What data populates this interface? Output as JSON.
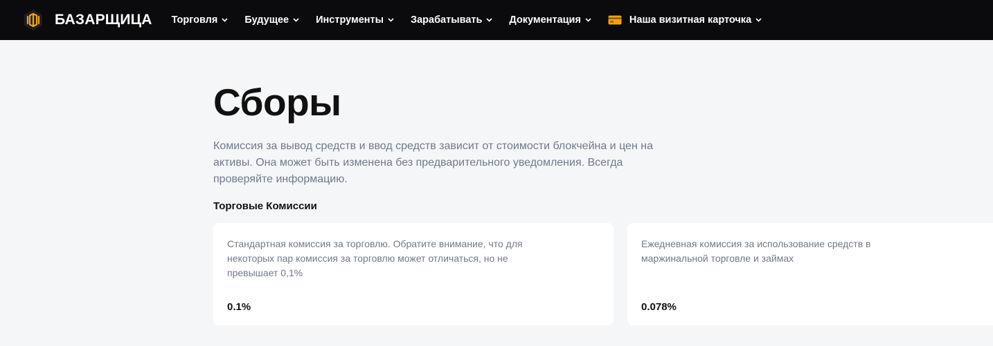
{
  "header": {
    "brand": "БАЗАРЩИЦА",
    "nav": [
      {
        "label": "Торговля"
      },
      {
        "label": "Будущее"
      },
      {
        "label": "Инструменты"
      },
      {
        "label": "Зарабатывать"
      },
      {
        "label": "Документация"
      },
      {
        "label": "Наша визитная карточка",
        "icon": "card-icon"
      }
    ]
  },
  "colors": {
    "header_bg": "#0b0b0e",
    "page_bg": "#f5f6f8",
    "accent": "#f0a30a"
  },
  "main": {
    "title": "Сборы",
    "intro": "Комиссия за вывод средств и ввод средств зависит от стоимости блокчейна и цен на активы. Она может быть изменена без предварительного уведомления. Всегда проверяйте информацию.",
    "section_title": "Торговые Комиссии",
    "cards": [
      {
        "description": "Стандартная комиссия за торговлю. Обратите внимание, что для некоторых пар комиссия за торговлю может отличаться, но не превышает 0,1%",
        "value": "0.1%"
      },
      {
        "description": "Ежедневная комиссия за использование средств в маржинальной торговле и займах",
        "value": "0.078%"
      }
    ]
  }
}
